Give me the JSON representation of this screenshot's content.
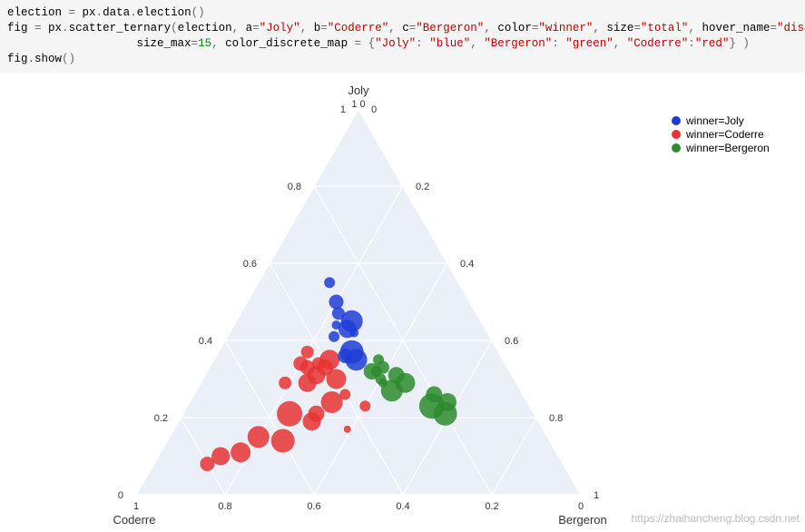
{
  "code": {
    "line1_a": "election ",
    "line1_b": "=",
    "line1_c": " px",
    "line1_d": ".",
    "line1_e": "data",
    "line1_f": ".",
    "line1_g": "election",
    "line1_h": "()",
    "line2_a": "fig ",
    "line2_b": "=",
    "line2_c": " px",
    "line2_d": ".",
    "line2_e": "scatter_ternary",
    "line2_f": "(",
    "line2_g": "election",
    "line2_h": ", ",
    "line2_i": "a",
    "line2_j": "=",
    "line2_k": "\"Joly\"",
    "line2_l": ", ",
    "line2_m": "b",
    "line2_n": "=",
    "line2_o": "\"Coderre\"",
    "line2_p": ", ",
    "line2_q": "c",
    "line2_r": "=",
    "line2_s": "\"Bergeron\"",
    "line2_t": ", ",
    "line2_u": "color",
    "line2_v": "=",
    "line2_w": "\"winner\"",
    "line2_x": ", ",
    "line2_y": "size",
    "line2_z": "=",
    "line2_aa": "\"total\"",
    "line2_ab": ", ",
    "line2_ac": "hover_name",
    "line2_ad": "=",
    "line2_ae": "\"district\"",
    "line2_af": ",",
    "line3_a": "                   size_max",
    "line3_b": "=",
    "line3_c": "15",
    "line3_d": ", ",
    "line3_e": "color_discrete_map ",
    "line3_f": "=",
    "line3_g": " {",
    "line3_h": "\"Joly\"",
    "line3_i": ": ",
    "line3_j": "\"blue\"",
    "line3_k": ", ",
    "line3_l": "\"Bergeron\"",
    "line3_m": ": ",
    "line3_n": "\"green\"",
    "line3_o": ", ",
    "line3_p": "\"Coderre\"",
    "line3_q": ":",
    "line3_r": "\"red\"",
    "line3_s": "} )",
    "line4_a": "fig",
    "line4_b": ".",
    "line4_c": "show",
    "line4_d": "()"
  },
  "axes": {
    "a": "Joly",
    "b": "Coderre",
    "c": "Bergeron",
    "title_b_c": "1 0"
  },
  "ticks": [
    "0",
    "0.2",
    "0.4",
    "0.6",
    "0.8",
    "1"
  ],
  "legend": {
    "items": [
      {
        "label": "winner=Joly",
        "color": "#1f3dd6"
      },
      {
        "label": "winner=Coderre",
        "color": "#e63232"
      },
      {
        "label": "winner=Bergeron",
        "color": "#2e8b2e"
      }
    ]
  },
  "colors": {
    "Joly": "#1f3dd6",
    "Coderre": "#e63232",
    "Bergeron": "#2e8b2e",
    "bg": "#ebf0f8",
    "grid": "#ffffff"
  },
  "watermark": "https://zhaihancheng.blog.csdn.net",
  "chart_data": {
    "type": "ternary-scatter",
    "a_axis": "Joly",
    "b_axis": "Coderre",
    "c_axis": "Bergeron",
    "axis_range": [
      0,
      1
    ],
    "grid_step": 0.2,
    "size_encodes": "total",
    "color_encodes": "winner",
    "color_map": {
      "Joly": "blue",
      "Coderre": "red",
      "Bergeron": "green"
    },
    "legend_pos": "right",
    "points": [
      {
        "a": 0.3,
        "b": 0.4,
        "c": 0.3,
        "size": 11,
        "winner": "Coderre"
      },
      {
        "a": 0.24,
        "b": 0.44,
        "c": 0.32,
        "size": 12,
        "winner": "Coderre"
      },
      {
        "a": 0.19,
        "b": 0.51,
        "c": 0.3,
        "size": 10,
        "winner": "Coderre"
      },
      {
        "a": 0.33,
        "b": 0.41,
        "c": 0.26,
        "size": 9,
        "winner": "Coderre"
      },
      {
        "a": 0.21,
        "b": 0.55,
        "c": 0.24,
        "size": 14,
        "winner": "Coderre"
      },
      {
        "a": 0.14,
        "b": 0.6,
        "c": 0.26,
        "size": 13,
        "winner": "Coderre"
      },
      {
        "a": 0.23,
        "b": 0.37,
        "c": 0.4,
        "size": 6,
        "winner": "Coderre"
      },
      {
        "a": 0.34,
        "b": 0.46,
        "c": 0.2,
        "size": 8,
        "winner": "Coderre"
      },
      {
        "a": 0.26,
        "b": 0.4,
        "c": 0.34,
        "size": 6,
        "winner": "Coderre"
      },
      {
        "a": 0.15,
        "b": 0.65,
        "c": 0.2,
        "size": 12,
        "winner": "Coderre"
      },
      {
        "a": 0.11,
        "b": 0.71,
        "c": 0.18,
        "size": 11,
        "winner": "Coderre"
      },
      {
        "a": 0.1,
        "b": 0.76,
        "c": 0.14,
        "size": 10,
        "winner": "Coderre"
      },
      {
        "a": 0.08,
        "b": 0.8,
        "c": 0.12,
        "size": 8,
        "winner": "Coderre"
      },
      {
        "a": 0.35,
        "b": 0.39,
        "c": 0.26,
        "size": 11,
        "winner": "Coderre"
      },
      {
        "a": 0.17,
        "b": 0.44,
        "c": 0.39,
        "size": 4,
        "winner": "Coderre"
      },
      {
        "a": 0.29,
        "b": 0.47,
        "c": 0.24,
        "size": 10,
        "winner": "Coderre"
      },
      {
        "a": 0.34,
        "b": 0.42,
        "c": 0.24,
        "size": 7,
        "winner": "Coderre"
      },
      {
        "a": 0.21,
        "b": 0.49,
        "c": 0.3,
        "size": 9,
        "winner": "Coderre"
      },
      {
        "a": 0.33,
        "b": 0.45,
        "c": 0.22,
        "size": 8,
        "winner": "Coderre"
      },
      {
        "a": 0.37,
        "b": 0.43,
        "c": 0.2,
        "size": 7,
        "winner": "Coderre"
      },
      {
        "a": 0.29,
        "b": 0.52,
        "c": 0.19,
        "size": 7,
        "winner": "Coderre"
      },
      {
        "a": 0.31,
        "b": 0.44,
        "c": 0.25,
        "size": 10,
        "winner": "Coderre"
      },
      {
        "a": 0.45,
        "b": 0.29,
        "c": 0.26,
        "size": 12,
        "winner": "Joly"
      },
      {
        "a": 0.43,
        "b": 0.31,
        "c": 0.26,
        "size": 10,
        "winner": "Joly"
      },
      {
        "a": 0.37,
        "b": 0.33,
        "c": 0.3,
        "size": 13,
        "winner": "Joly"
      },
      {
        "a": 0.35,
        "b": 0.33,
        "c": 0.32,
        "size": 12,
        "winner": "Joly"
      },
      {
        "a": 0.5,
        "b": 0.3,
        "c": 0.2,
        "size": 8,
        "winner": "Joly"
      },
      {
        "a": 0.55,
        "b": 0.29,
        "c": 0.16,
        "size": 6,
        "winner": "Joly"
      },
      {
        "a": 0.47,
        "b": 0.31,
        "c": 0.22,
        "size": 7,
        "winner": "Joly"
      },
      {
        "a": 0.41,
        "b": 0.35,
        "c": 0.24,
        "size": 6,
        "winner": "Joly"
      },
      {
        "a": 0.44,
        "b": 0.33,
        "c": 0.23,
        "size": 5,
        "winner": "Joly"
      },
      {
        "a": 0.42,
        "b": 0.3,
        "c": 0.28,
        "size": 5,
        "winner": "Joly"
      },
      {
        "a": 0.36,
        "b": 0.35,
        "c": 0.29,
        "size": 8,
        "winner": "Joly"
      },
      {
        "a": 0.29,
        "b": 0.25,
        "c": 0.46,
        "size": 11,
        "winner": "Bergeron"
      },
      {
        "a": 0.27,
        "b": 0.29,
        "c": 0.44,
        "size": 12,
        "winner": "Bergeron"
      },
      {
        "a": 0.32,
        "b": 0.31,
        "c": 0.37,
        "size": 9,
        "winner": "Bergeron"
      },
      {
        "a": 0.23,
        "b": 0.22,
        "c": 0.55,
        "size": 14,
        "winner": "Bergeron"
      },
      {
        "a": 0.21,
        "b": 0.2,
        "c": 0.59,
        "size": 13,
        "winner": "Bergeron"
      },
      {
        "a": 0.26,
        "b": 0.2,
        "c": 0.54,
        "size": 9,
        "winner": "Bergeron"
      },
      {
        "a": 0.31,
        "b": 0.26,
        "c": 0.43,
        "size": 9,
        "winner": "Bergeron"
      },
      {
        "a": 0.33,
        "b": 0.28,
        "c": 0.39,
        "size": 7,
        "winner": "Bergeron"
      },
      {
        "a": 0.24,
        "b": 0.18,
        "c": 0.58,
        "size": 10,
        "winner": "Bergeron"
      },
      {
        "a": 0.32,
        "b": 0.3,
        "c": 0.38,
        "size": 6,
        "winner": "Bergeron"
      },
      {
        "a": 0.3,
        "b": 0.3,
        "c": 0.4,
        "size": 6,
        "winner": "Bergeron"
      },
      {
        "a": 0.35,
        "b": 0.28,
        "c": 0.37,
        "size": 6,
        "winner": "Bergeron"
      },
      {
        "a": 0.29,
        "b": 0.3,
        "c": 0.41,
        "size": 5,
        "winner": "Bergeron"
      }
    ]
  }
}
